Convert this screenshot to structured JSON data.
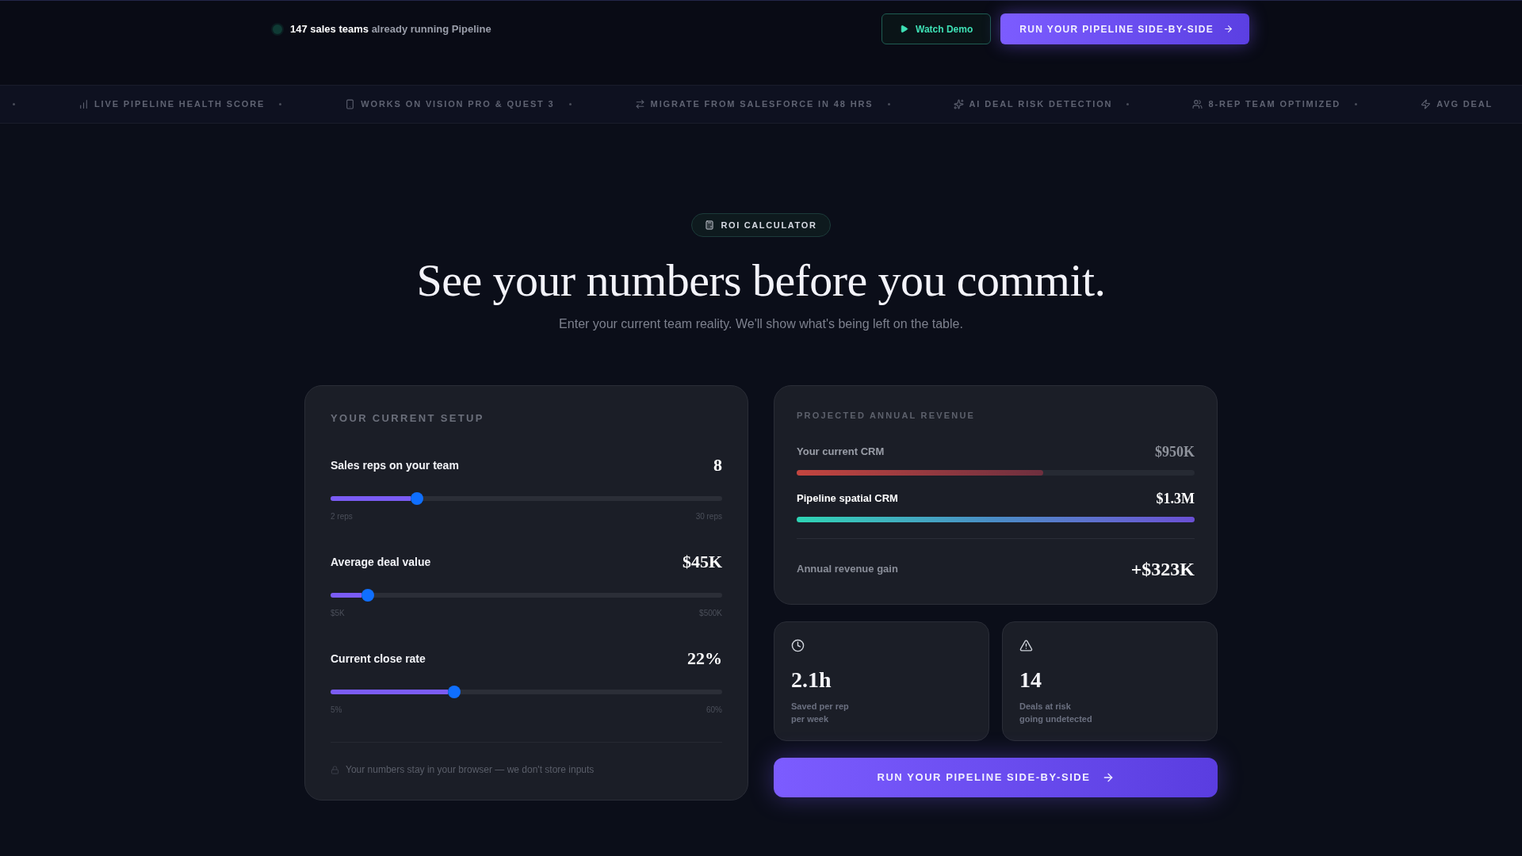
{
  "header": {
    "social_proof": "**147 sales teams** already running Pipeline",
    "watch_demo_button": "Watch Demo",
    "cta_button": "RUN YOUR PIPELINE SIDE-BY-SIDE"
  },
  "ticker": [
    "LIVE PIPELINE HEALTH SCORE",
    "WORKS ON VISION PRO & QUEST 3",
    "MIGRATE FROM SALESFORCE IN 48 HRS",
    "AI DEAL RISK DETECTION",
    "8-REP TEAM OPTIMIZED",
    "AVG DEAL"
  ],
  "hero": {
    "badge": "ROI CALCULATOR",
    "title": "See your numbers before you commit.",
    "subtitle": "Enter your current team reality. We'll show what's being left on the table."
  },
  "setup": {
    "title": "YOUR CURRENT SETUP",
    "sliders": [
      {
        "label": "Sales reps on your team",
        "value": "8",
        "level": 0.22,
        "min_label": "2 reps",
        "max_label": "30 reps"
      },
      {
        "label": "Average deal value",
        "value": "$45K",
        "level": 0.095,
        "min_label": "$5K",
        "max_label": "$500K"
      },
      {
        "label": "Current close rate",
        "value": "22%",
        "level": 0.315,
        "min_label": "5%",
        "max_label": "60%"
      }
    ],
    "privacy_note": "Your numbers stay in your browser — we don't store inputs"
  },
  "revenue": {
    "title": "PROJECTED ANNUAL REVENUE",
    "bars": [
      {
        "kind": "current",
        "label": "Your current CRM",
        "value": "$950K",
        "level": 0.62
      },
      {
        "kind": "pipeline",
        "label": "Pipeline spatial CRM",
        "value": "$1.3M",
        "level": 1
      }
    ],
    "gain": {
      "label": "Annual revenue gain",
      "value": "+$323K"
    }
  },
  "stats": [
    {
      "value": "2.1h",
      "caption": "Saved per rep\nper week"
    },
    {
      "value": "14",
      "caption": "Deals at risk\ngoing undetected"
    }
  ],
  "cta_button": "RUN YOUR PIPELINE SIDE-BY-SIDE"
}
